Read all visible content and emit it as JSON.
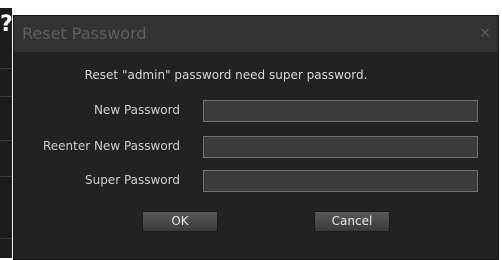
{
  "background": {
    "glyph": "?"
  },
  "dialog": {
    "title": "Reset Password",
    "close_icon": "×",
    "message": "Reset \"admin\" password need super password.",
    "fields": {
      "new_password": {
        "label": "New Password",
        "value": ""
      },
      "reenter_password": {
        "label": "Reenter New Password",
        "value": ""
      },
      "super_password": {
        "label": "Super Password",
        "value": ""
      }
    },
    "buttons": {
      "ok": "OK",
      "cancel": "Cancel"
    }
  },
  "colors": {
    "dialog_bg": "#222222",
    "titlebar_bg": "#333333",
    "field_bg": "#3c3c3c"
  }
}
